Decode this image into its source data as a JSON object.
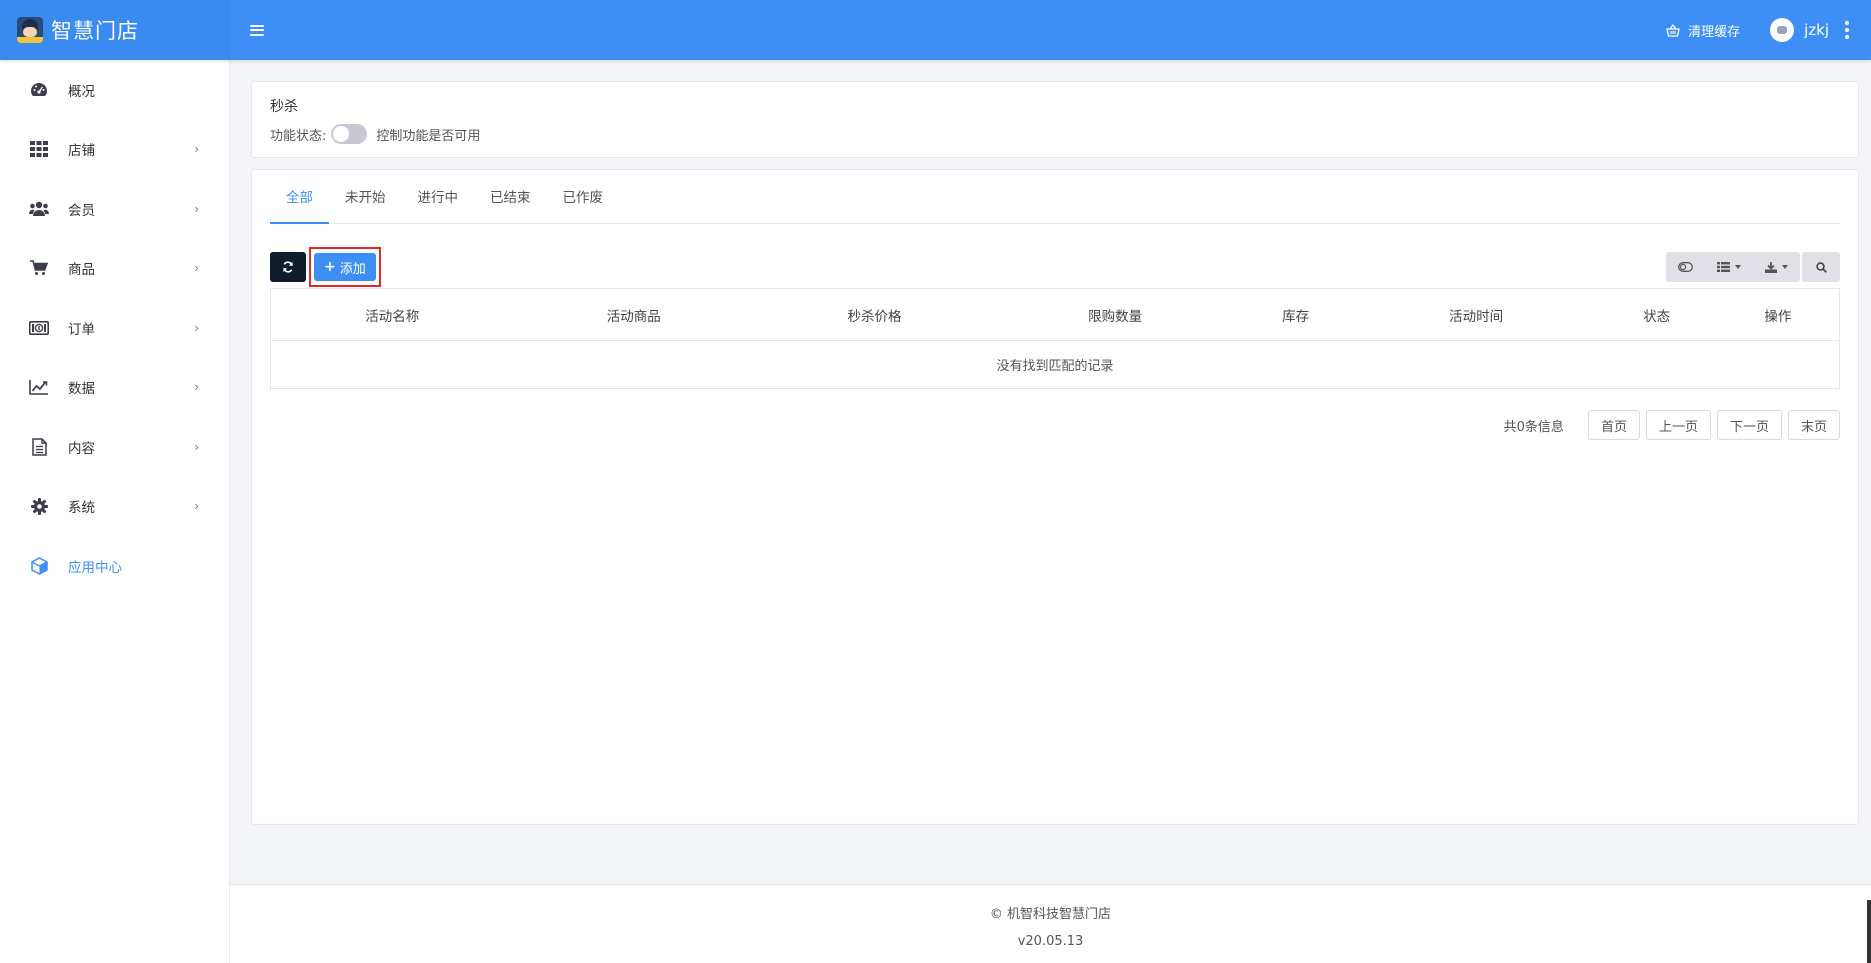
{
  "app": {
    "title": "智慧门店"
  },
  "topbar": {
    "clear_cache": "清理缓存",
    "username": "jzkj"
  },
  "sidebar": {
    "items": [
      {
        "label": "概况",
        "icon": "dashboard-icon",
        "has_children": false
      },
      {
        "label": "店铺",
        "icon": "grid-icon",
        "has_children": true
      },
      {
        "label": "会员",
        "icon": "users-icon",
        "has_children": true
      },
      {
        "label": "商品",
        "icon": "cart-icon",
        "has_children": true
      },
      {
        "label": "订单",
        "icon": "money-icon",
        "has_children": true
      },
      {
        "label": "数据",
        "icon": "line-chart-icon",
        "has_children": true
      },
      {
        "label": "内容",
        "icon": "document-icon",
        "has_children": true
      },
      {
        "label": "系统",
        "icon": "gear-icon",
        "has_children": true
      },
      {
        "label": "应用中心",
        "icon": "cube-icon",
        "has_children": false,
        "active": true
      }
    ]
  },
  "feature": {
    "title": "秒杀",
    "status_label": "功能状态:",
    "toggle_on": false,
    "toggle_desc": "控制功能是否可用"
  },
  "tabs": [
    "全部",
    "未开始",
    "进行中",
    "已结束",
    "已作废"
  ],
  "active_tab": 0,
  "toolbar": {
    "add_label": "添加"
  },
  "table": {
    "columns": [
      "活动名称",
      "活动商品",
      "秒杀价格",
      "限购数量",
      "库存",
      "活动时间",
      "状态",
      "操作"
    ],
    "empty_text": "没有找到匹配的记录"
  },
  "pagination": {
    "info": "共0条信息",
    "first": "首页",
    "prev": "上一页",
    "next": "下一页",
    "last": "末页"
  },
  "footer": {
    "copyright": "© 机智科技智慧门店",
    "version": "v20.05.13"
  },
  "colors": {
    "primary": "#3d8ff5",
    "dark_button": "#0f1c2e",
    "highlight_border": "#e02a2a"
  }
}
